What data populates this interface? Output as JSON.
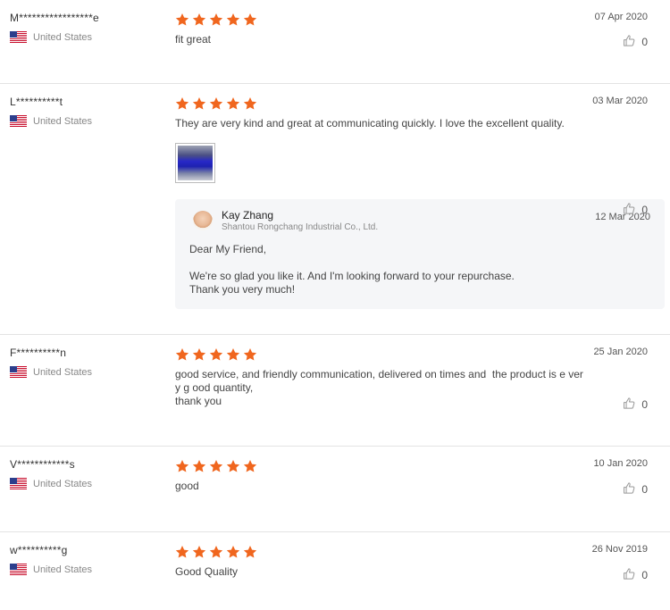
{
  "reviews": [
    {
      "username": "M*****************e",
      "country": "United States",
      "rating": 5,
      "comment": "fit great",
      "date": "07 Apr 2020",
      "likes": "0"
    },
    {
      "username": "L**********t",
      "country": "United States",
      "rating": 5,
      "comment": "They are very kind and great at communicating quickly. I love the excellent quality.",
      "date": "03 Mar 2020",
      "likes": "0",
      "reply": {
        "name": "Kay Zhang",
        "company": "Shantou Rongchang Industrial Co., Ltd.",
        "date": "12 Mar 2020",
        "greeting": "Dear My Friend,",
        "line1": "We're so glad you like it. And I'm looking forward to your repurchase.",
        "line2": "Thank you very much!"
      }
    },
    {
      "username": "F**********n",
      "country": "United States",
      "rating": 5,
      "comment": "good service, and friendly communication, delivered on times and  the product is e very g ood quantity,\nthank you",
      "date": "25 Jan 2020",
      "likes": "0"
    },
    {
      "username": "V************s",
      "country": "United States",
      "rating": 5,
      "comment": "good",
      "date": "10 Jan 2020",
      "likes": "0"
    },
    {
      "username": "w**********g",
      "country": "United States",
      "rating": 5,
      "comment": "Good Quality",
      "date": "26 Nov 2019",
      "likes": "0"
    }
  ],
  "colors": {
    "star": "#f0661e",
    "flag_red": "#c8102e",
    "flag_blue": "#2c3e8c",
    "divider": "#e3e3e3"
  },
  "icons": {
    "flag": "us-flag-icon",
    "star": "star-icon",
    "like": "thumbs-up-icon"
  }
}
